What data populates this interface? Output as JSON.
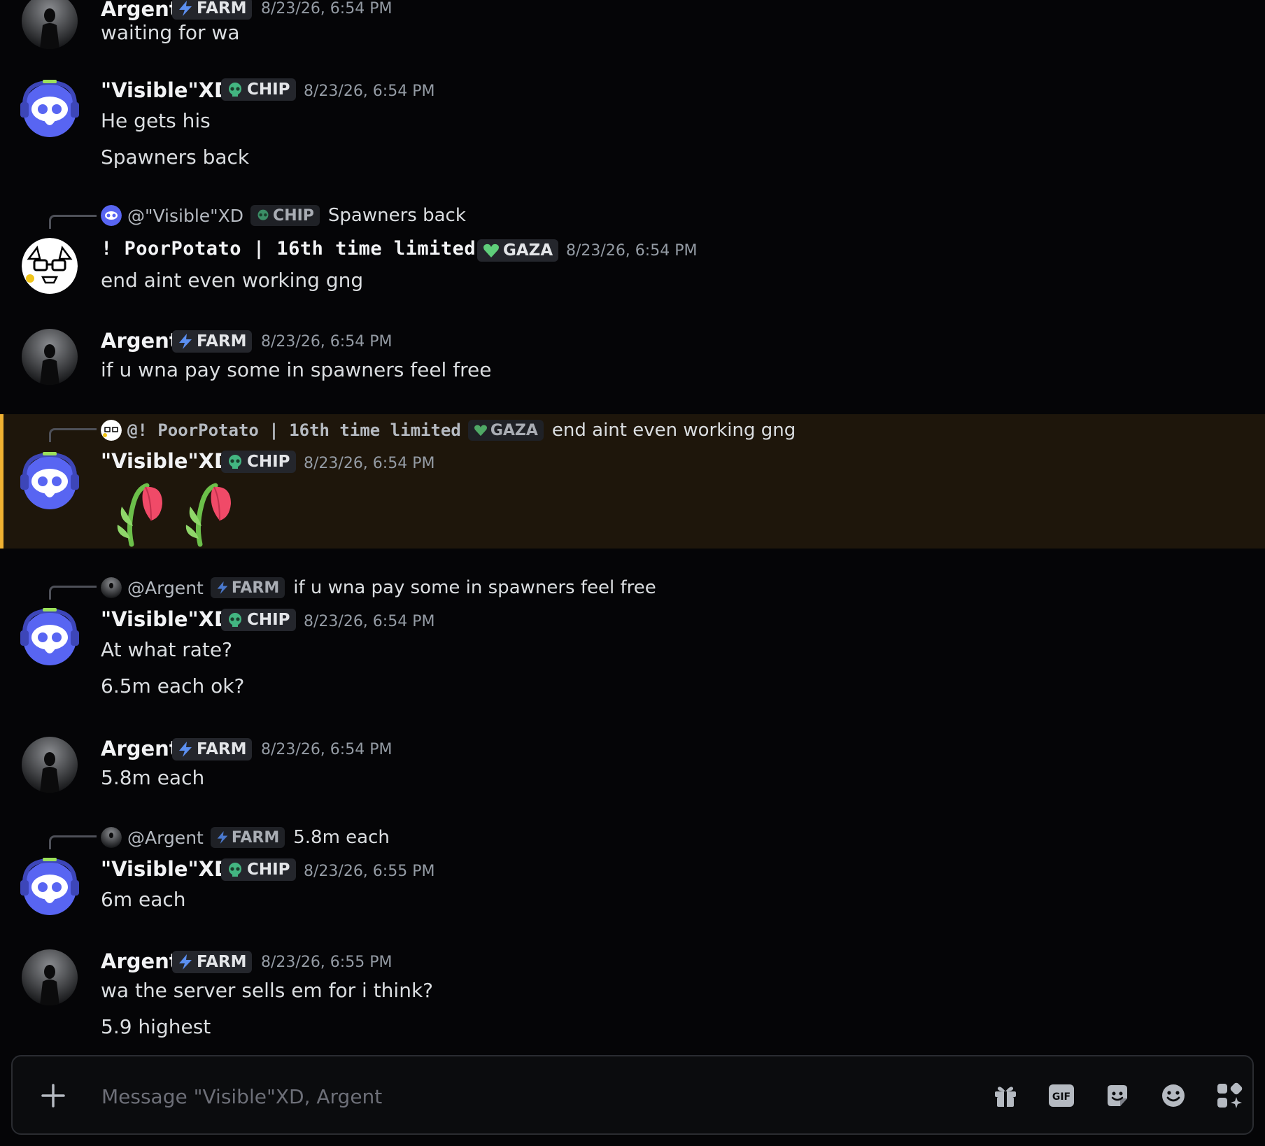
{
  "messages": [
    {
      "author": "Argent",
      "tag": "FARM",
      "time": "8/23/26, 6:54 PM",
      "lines": [
        "waiting for wa"
      ]
    },
    {
      "author": "\"Visible\"XD",
      "tag": "CHIP",
      "time": "8/23/26, 6:54 PM",
      "lines": [
        "He gets his",
        "Spawners back"
      ]
    },
    {
      "reply": {
        "author": "@\"Visible\"XD",
        "tag": "CHIP",
        "text": "Spawners back"
      },
      "author": "! PoorPotato | 16th time limited",
      "tag": "GAZA",
      "time": "8/23/26, 6:54 PM",
      "lines": [
        "end aint even working gng"
      ]
    },
    {
      "author": "Argent",
      "tag": "FARM",
      "time": "8/23/26, 6:54 PM",
      "lines": [
        "if u wna pay some in spawners feel free"
      ]
    },
    {
      "reply": {
        "author": "@! PoorPotato | 16th time limited",
        "tag": "GAZA",
        "text": "end aint even working gng"
      },
      "author": "\"Visible\"XD",
      "tag": "CHIP",
      "time": "8/23/26, 6:54 PM",
      "emojis": [
        "wilted-flower-emoji",
        "wilted-flower-emoji"
      ]
    },
    {
      "reply": {
        "author": "@Argent",
        "tag": "FARM",
        "text": "if u wna pay some in spawners feel free"
      },
      "author": "\"Visible\"XD",
      "tag": "CHIP",
      "time": "8/23/26, 6:54 PM",
      "lines": [
        "At what rate?",
        "6.5m each ok?"
      ]
    },
    {
      "author": "Argent",
      "tag": "FARM",
      "time": "8/23/26, 6:54 PM",
      "lines": [
        "5.8m each"
      ]
    },
    {
      "reply": {
        "author": "@Argent",
        "tag": "FARM",
        "text": "5.8m each"
      },
      "author": "\"Visible\"XD",
      "tag": "CHIP",
      "time": "8/23/26, 6:55 PM",
      "lines": [
        "6m each"
      ]
    },
    {
      "author": "Argent",
      "tag": "FARM",
      "time": "8/23/26, 6:55 PM",
      "lines": [
        "wa the server sells em for i think?",
        "5.9 highest"
      ]
    }
  ],
  "composer": {
    "placeholder": "Message \"Visible\"XD, Argent",
    "icons": [
      "plus-icon",
      "gift-icon",
      "gif-icon",
      "sticker-icon",
      "emoji-icon",
      "apps-icon"
    ],
    "gif_label": "GIF"
  },
  "colors": {
    "background": "#050507",
    "highlight_bg": "#1e160b",
    "highlight_bar": "#f0b232",
    "discord_blurple": "#5865f2",
    "muted_text": "#949ba4"
  }
}
